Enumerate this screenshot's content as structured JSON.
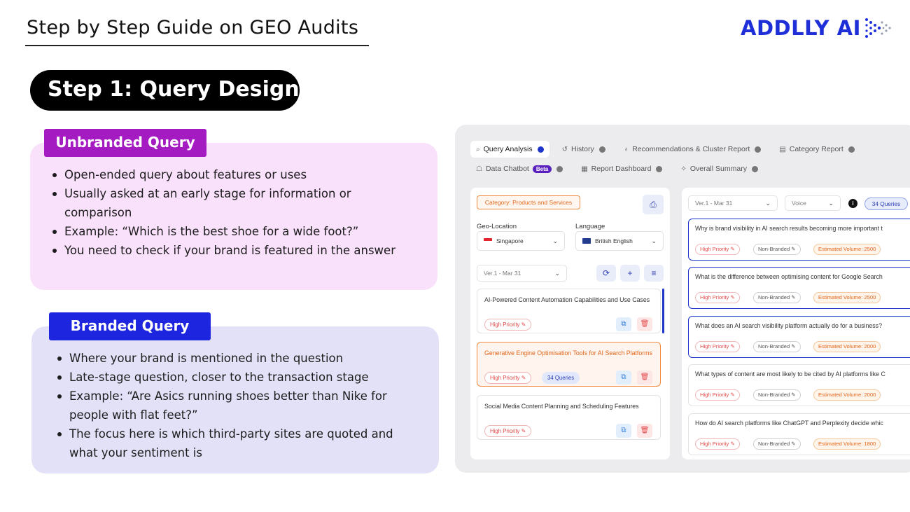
{
  "header": {
    "title": "Step by Step Guide on GEO Audits",
    "logo_text": "ADDLLY AI",
    "step_label": "Step 1: Query Design"
  },
  "unbranded": {
    "tag": "Unbranded Query",
    "points": [
      "Open-ended query about features or uses",
      "Usually asked at an early stage for information or comparison",
      "Example: “Which is the best shoe for a wide foot?”",
      "You need to check if your brand is featured in the answer"
    ]
  },
  "branded": {
    "tag": "Branded Query",
    "points": [
      "Where your brand is mentioned in the question",
      "Late-stage question, closer to the transaction stage",
      "Example: “Are Asics running shoes better than Nike for people with flat feet?”",
      "The focus here is which third-party sites are quoted and what your sentiment is"
    ]
  },
  "app": {
    "tabs_row1": [
      {
        "label": "Query Analysis",
        "icon": "search-icon",
        "active": true
      },
      {
        "label": "History",
        "icon": "history-icon"
      },
      {
        "label": "Recommendations & Cluster Report",
        "icon": "lightbulb-icon"
      },
      {
        "label": "Category Report",
        "icon": "document-icon"
      }
    ],
    "tabs_row2": [
      {
        "label": "Data Chatbot",
        "icon": "robot-icon",
        "badge": "Beta"
      },
      {
        "label": "Report Dashboard",
        "icon": "grid-icon"
      },
      {
        "label": "Overall Summary",
        "icon": "sparkle-icon"
      }
    ],
    "left": {
      "category": "Category: Products and Services",
      "geo_label": "Geo-Location",
      "geo_value": "Singapore",
      "lang_label": "Language",
      "lang_value": "British English",
      "version": "Ver.1 - Mar 31",
      "topics": [
        {
          "title": "AI-Powered Content Automation Capabilities and Use Cases",
          "priority": "High Priority"
        },
        {
          "title": "Generative Engine Optimisation Tools for AI Search Platforms",
          "priority": "High Priority",
          "queries": "34 Queries",
          "selected": true
        },
        {
          "title": "Social Media Content Planning and Scheduling Features",
          "priority": "High Priority"
        }
      ]
    },
    "right": {
      "version": "Ver.1 - Mar 31",
      "voice": "Voice",
      "count": "34 Queries",
      "queries": [
        {
          "text": "Why is brand visibility in AI search results becoming more important t",
          "priority": "High Priority",
          "branding": "Non-Branded",
          "volume": "Estimated Volume: 2500"
        },
        {
          "text": "What is the difference between optimising content for Google Search",
          "priority": "High Priority",
          "branding": "Non-Branded",
          "volume": "Estimated Volume: 2500"
        },
        {
          "text": "What does an AI search visibility platform actually do for a business?",
          "priority": "High Priority",
          "branding": "Non-Branded",
          "volume": "Estimated Volume: 2000"
        },
        {
          "text": "What types of content are most likely to be cited by AI platforms like C",
          "priority": "High Priority",
          "branding": "Non-Branded",
          "volume": "Estimated Volume: 2000"
        },
        {
          "text": "How do AI search platforms like ChatGPT and Perplexity decide whic",
          "priority": "High Priority",
          "branding": "Non-Branded",
          "volume": "Estimated Volume: 1800"
        }
      ]
    }
  },
  "colors": {
    "brand_blue": "#1f2fd8",
    "unbranded_tag": "#a51bc2",
    "branded_tag": "#1d26de",
    "unbranded_bg": "#f9e0fb",
    "branded_bg": "#e2e1f8"
  }
}
